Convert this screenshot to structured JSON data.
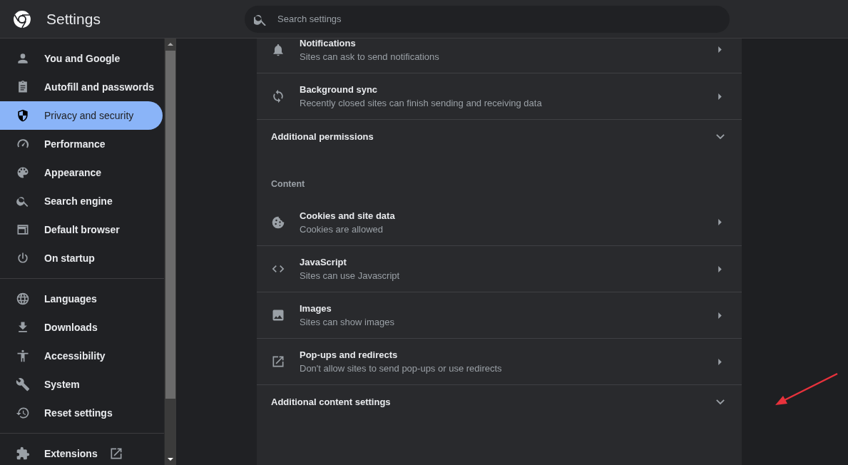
{
  "header": {
    "title": "Settings",
    "search": {
      "placeholder": "Search settings"
    }
  },
  "sidebar": {
    "groups": [
      [
        {
          "label": "You and Google",
          "selected": false
        },
        {
          "label": "Autofill and passwords",
          "selected": false
        },
        {
          "label": "Privacy and security",
          "selected": true
        },
        {
          "label": "Performance",
          "selected": false
        },
        {
          "label": "Appearance",
          "selected": false
        },
        {
          "label": "Search engine",
          "selected": false
        },
        {
          "label": "Default browser",
          "selected": false
        },
        {
          "label": "On startup",
          "selected": false
        }
      ],
      [
        {
          "label": "Languages",
          "selected": false
        },
        {
          "label": "Downloads",
          "selected": false
        },
        {
          "label": "Accessibility",
          "selected": false
        },
        {
          "label": "System",
          "selected": false
        },
        {
          "label": "Reset settings",
          "selected": false
        }
      ],
      [
        {
          "label": "Extensions",
          "selected": false,
          "external": true
        }
      ]
    ]
  },
  "content": {
    "rows": [
      {
        "kind": "link",
        "title": "Notifications",
        "subtitle": "Sites can ask to send notifications"
      },
      {
        "kind": "link",
        "title": "Background sync",
        "subtitle": "Recently closed sites can finish sending and receiving data"
      },
      {
        "kind": "expand",
        "title": "Additional permissions",
        "expanded": false
      },
      {
        "kind": "heading",
        "title": "Content"
      },
      {
        "kind": "link",
        "title": "Cookies and site data",
        "subtitle": "Cookies are allowed"
      },
      {
        "kind": "link",
        "title": "JavaScript",
        "subtitle": "Sites can use Javascript"
      },
      {
        "kind": "link",
        "title": "Images",
        "subtitle": "Sites can show images"
      },
      {
        "kind": "link",
        "title": "Pop-ups and redirects",
        "subtitle": "Don't allow sites to send pop-ups or use redirects"
      },
      {
        "kind": "expand",
        "title": "Additional content settings",
        "expanded": false
      }
    ]
  }
}
